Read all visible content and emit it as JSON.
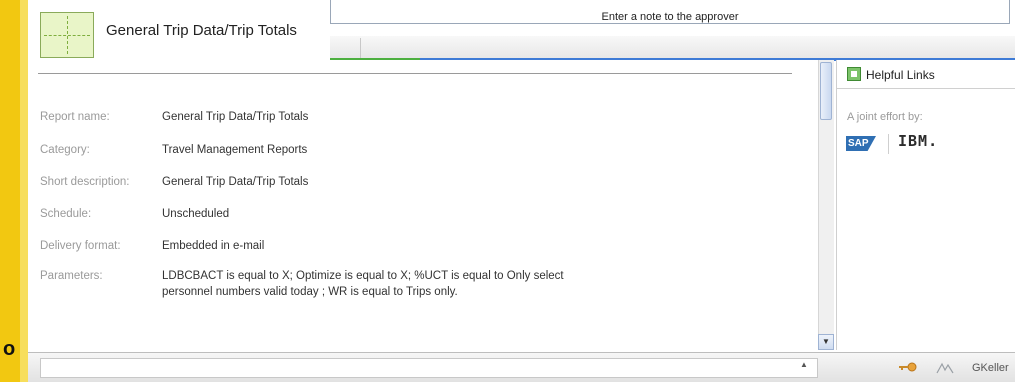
{
  "approver": {
    "note_placeholder": "Enter a note to the approver"
  },
  "report": {
    "title": "General Trip Data/Trip Totals",
    "fields": [
      {
        "label": "Report name:",
        "value": "General Trip Data/Trip Totals"
      },
      {
        "label": "Category:",
        "value": "Travel Management Reports"
      },
      {
        "label": "Short description:",
        "value": "General Trip Data/Trip Totals"
      },
      {
        "label": "Schedule:",
        "value": "Unscheduled"
      },
      {
        "label": "Delivery format:",
        "value": "Embedded in e-mail"
      },
      {
        "label": "Parameters:",
        "value": "LDBCBACT is equal to X; Optimize is equal to X; %UCT is equal to Only select personnel numbers valid today ; WR is equal to Trips only."
      }
    ]
  },
  "sidebar": {
    "helpful_links": "Helpful Links",
    "joint_effort": "A joint effort by:",
    "sap_logo": "SAP",
    "ibm_logo": "IBM."
  },
  "status": {
    "user": "GKeller",
    "cut_text": "o"
  },
  "icons": {
    "report": "report-grid-icon",
    "helpful": "helpful-links-icon",
    "key": "key-icon",
    "sign": "signature-icon",
    "scroll_down": "chevron-down-icon"
  },
  "colors": {
    "accent_yellow": "#f2c811",
    "accent_blue": "#3e7bd6",
    "accent_green": "#4caf3f",
    "sap_blue": "#2f6fb3"
  }
}
